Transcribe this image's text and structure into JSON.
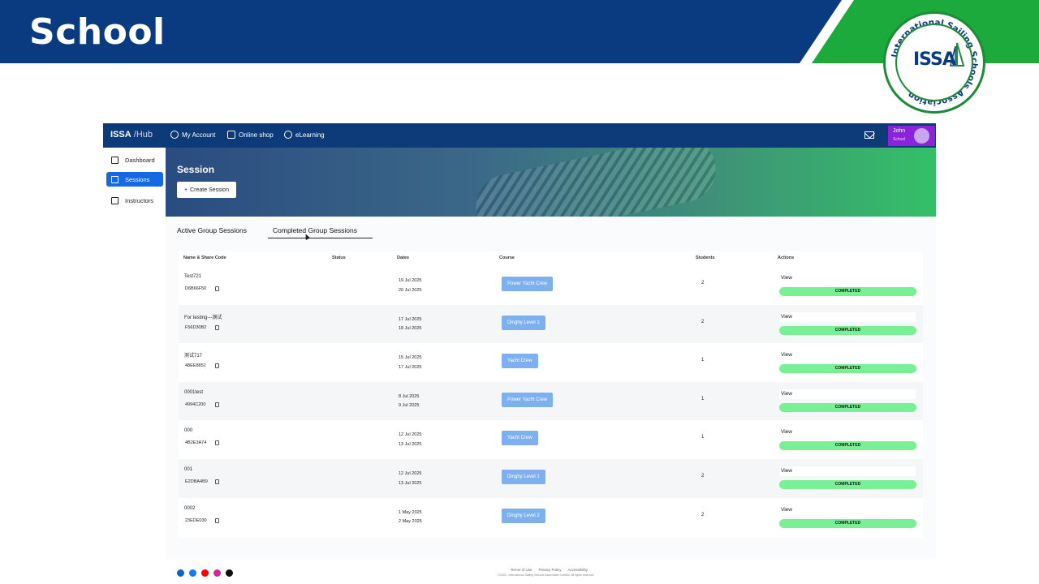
{
  "slide": {
    "title": "School",
    "logo_text": "International Sailing Schools Association",
    "logo_mark": "ISSA"
  },
  "app": {
    "brand": "ISSA",
    "brand_suffix": "Hub",
    "nav": [
      {
        "label": "My Account",
        "icon": "user-circle-icon"
      },
      {
        "label": "Online shop",
        "icon": "shop-icon"
      },
      {
        "label": "eLearning",
        "icon": "elearning-icon"
      }
    ],
    "user": {
      "name": "John",
      "role": "School"
    },
    "sidebar": [
      {
        "label": "Dashboard",
        "icon": "home-icon",
        "active": false
      },
      {
        "label": "Sessions",
        "icon": "sessions-icon",
        "active": true
      },
      {
        "label": "Instructors",
        "icon": "instructors-icon",
        "active": false
      }
    ],
    "hero": {
      "title": "Session",
      "create_button": "Create Session"
    },
    "tabs": {
      "active": "Active Group Sessions",
      "completed": "Completed Group Sessions"
    },
    "table": {
      "headers": [
        "Name & Share Code",
        "Status",
        "Dates",
        "Course",
        "Students",
        "Actions"
      ],
      "rows": [
        {
          "name": "Test721",
          "code": "D6B66F50",
          "start": "19 Jul 2025",
          "end": "20 Jul 2025",
          "course": "Power Yacht Crew",
          "students": "2",
          "view": "View",
          "status": "COMPLETED"
        },
        {
          "name": "For testing---测试",
          "code": "F56D30B2",
          "start": "17 Jul 2025",
          "end": "18 Jul 2025",
          "course": "Dinghy Level 1",
          "students": "2",
          "view": "View",
          "status": "COMPLETED"
        },
        {
          "name": "测试717",
          "code": "48EE8852",
          "start": "15 Jul 2025",
          "end": "17 Jul 2025",
          "course": "Yacht Crew",
          "students": "1",
          "view": "View",
          "status": "COMPLETED"
        },
        {
          "name": "0001test",
          "code": "4994C200",
          "start": "8 Jul 2025",
          "end": "9 Jul 2025",
          "course": "Power Yacht Crew",
          "students": "1",
          "view": "View",
          "status": "COMPLETED"
        },
        {
          "name": "000",
          "code": "4B2E3A74",
          "start": "12 Jul 2025",
          "end": "13 Jul 2025",
          "course": "Yacht Crew",
          "students": "1",
          "view": "View",
          "status": "COMPLETED"
        },
        {
          "name": "001",
          "code": "E2DBA4B9",
          "start": "12 Jul 2025",
          "end": "13 Jul 2025",
          "course": "Dinghy Level 1",
          "students": "2",
          "view": "View",
          "status": "COMPLETED"
        },
        {
          "name": "0002",
          "code": "23EDE030",
          "start": "1 May 2025",
          "end": "2 May 2025",
          "course": "Dinghy Level 2",
          "students": "2",
          "view": "View",
          "status": "COMPLETED"
        }
      ]
    },
    "footer": {
      "links": [
        "Terms of Use",
        "Privacy Policy",
        "Accessibility"
      ],
      "copyright": "©2025 - International Sailing Schools Association Limited. All rights reserved.",
      "social": [
        {
          "icon": "linkedin-icon",
          "color": "#0a66c2"
        },
        {
          "icon": "facebook-icon",
          "color": "#1877f2"
        },
        {
          "icon": "youtube-icon",
          "color": "#ff0000"
        },
        {
          "icon": "instagram-icon",
          "color": "#d6249f"
        },
        {
          "icon": "x-icon",
          "color": "#111111"
        }
      ]
    }
  },
  "colors": {
    "banner_blue": "#0a3a80",
    "banner_green": "#1daa3c",
    "nav_blue": "#0d3b7a",
    "active_blue": "#1668e3",
    "user_purple": "#8a23d9",
    "course_pill": "#7eb0ef",
    "completed_green": "#7af096"
  }
}
